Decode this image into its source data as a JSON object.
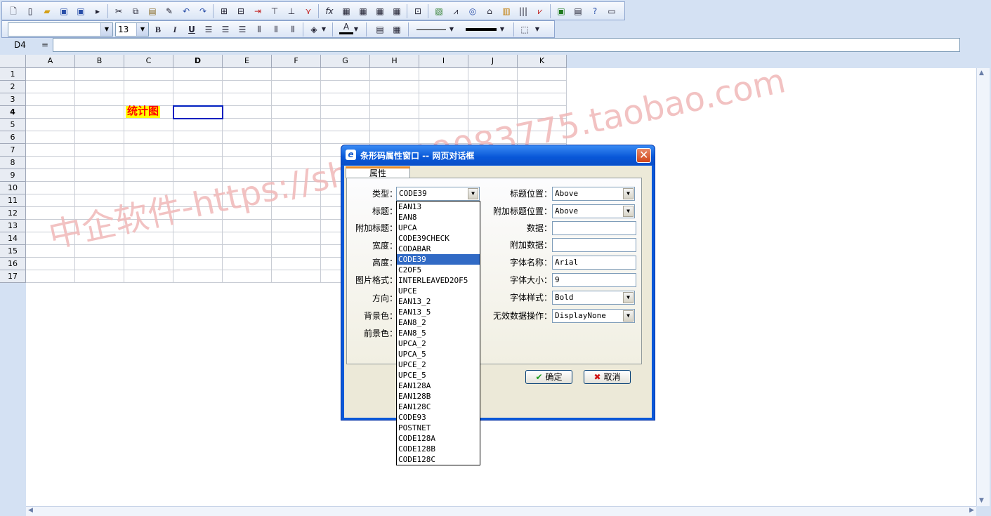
{
  "font_toolbar": {
    "font_name": "",
    "font_size": "13",
    "bold": "B",
    "italic": "I",
    "underline": "U",
    "text_color_glyph": "A"
  },
  "formula_bar": {
    "cell_ref": "D4",
    "equals": "=",
    "value": ""
  },
  "grid": {
    "columns": [
      "A",
      "B",
      "C",
      "D",
      "E",
      "F",
      "G",
      "H",
      "I",
      "J",
      "K"
    ],
    "rows": [
      "1",
      "2",
      "3",
      "4",
      "5",
      "6",
      "7",
      "8",
      "9",
      "10",
      "11",
      "12",
      "13",
      "14",
      "15",
      "16",
      "17"
    ],
    "c4_text": "统计图"
  },
  "watermark": "中企软件-https://shop119083775.taobao.com",
  "dialog": {
    "title": "条形码属性窗口 -- 网页对话框",
    "tab": "属性",
    "left_labels": [
      "类型：",
      "标题：",
      "附加标题：",
      "宽度：",
      "高度：",
      "图片格式：",
      "方向：",
      "背景色：",
      "前景色："
    ],
    "type_value": "CODE39",
    "right_labels": [
      "标题位置：",
      "附加标题位置：",
      "数据：",
      "附加数据：",
      "字体名称：",
      "字体大小：",
      "字体样式：",
      "无效数据操作："
    ],
    "title_position": "Above",
    "subtitle_position": "Above",
    "data": "",
    "extra_data": "",
    "font_name": "Arial",
    "font_size": "9",
    "font_style": "Bold",
    "invalid_action": "DisplayNone",
    "ok_label": "确定",
    "cancel_label": "取消",
    "type_options": [
      "EAN13",
      "EAN8",
      "UPCA",
      "CODE39CHECK",
      "CODABAR",
      "CODE39",
      "C2OF5",
      "INTERLEAVED2OF5",
      "UPCE",
      "EAN13_2",
      "EAN13_5",
      "EAN8_2",
      "EAN8_5",
      "UPCA_2",
      "UPCA_5",
      "UPCE_2",
      "UPCE_5",
      "EAN128A",
      "EAN128B",
      "EAN128C",
      "CODE93",
      "POSTNET",
      "CODE128A",
      "CODE128B",
      "CODE128C"
    ],
    "selected_option": "CODE39"
  },
  "colors": {
    "accent": "#316ac5",
    "title_bar": "#0857d8",
    "close": "#e0542c",
    "highlight_cell": "#ffff00",
    "highlight_text": "#ff0000",
    "watermark": "#f0b8b8"
  },
  "icons": [
    "new-file-icon",
    "open-folder-icon",
    "save-icon",
    "cut-icon",
    "copy-icon",
    "paste-icon",
    "undo-icon",
    "redo-icon",
    "function-icon",
    "chart-icon",
    "barcode-icon",
    "excel-icon",
    "help-icon",
    "ie-icon",
    "close-icon",
    "check-icon",
    "cross-icon"
  ]
}
